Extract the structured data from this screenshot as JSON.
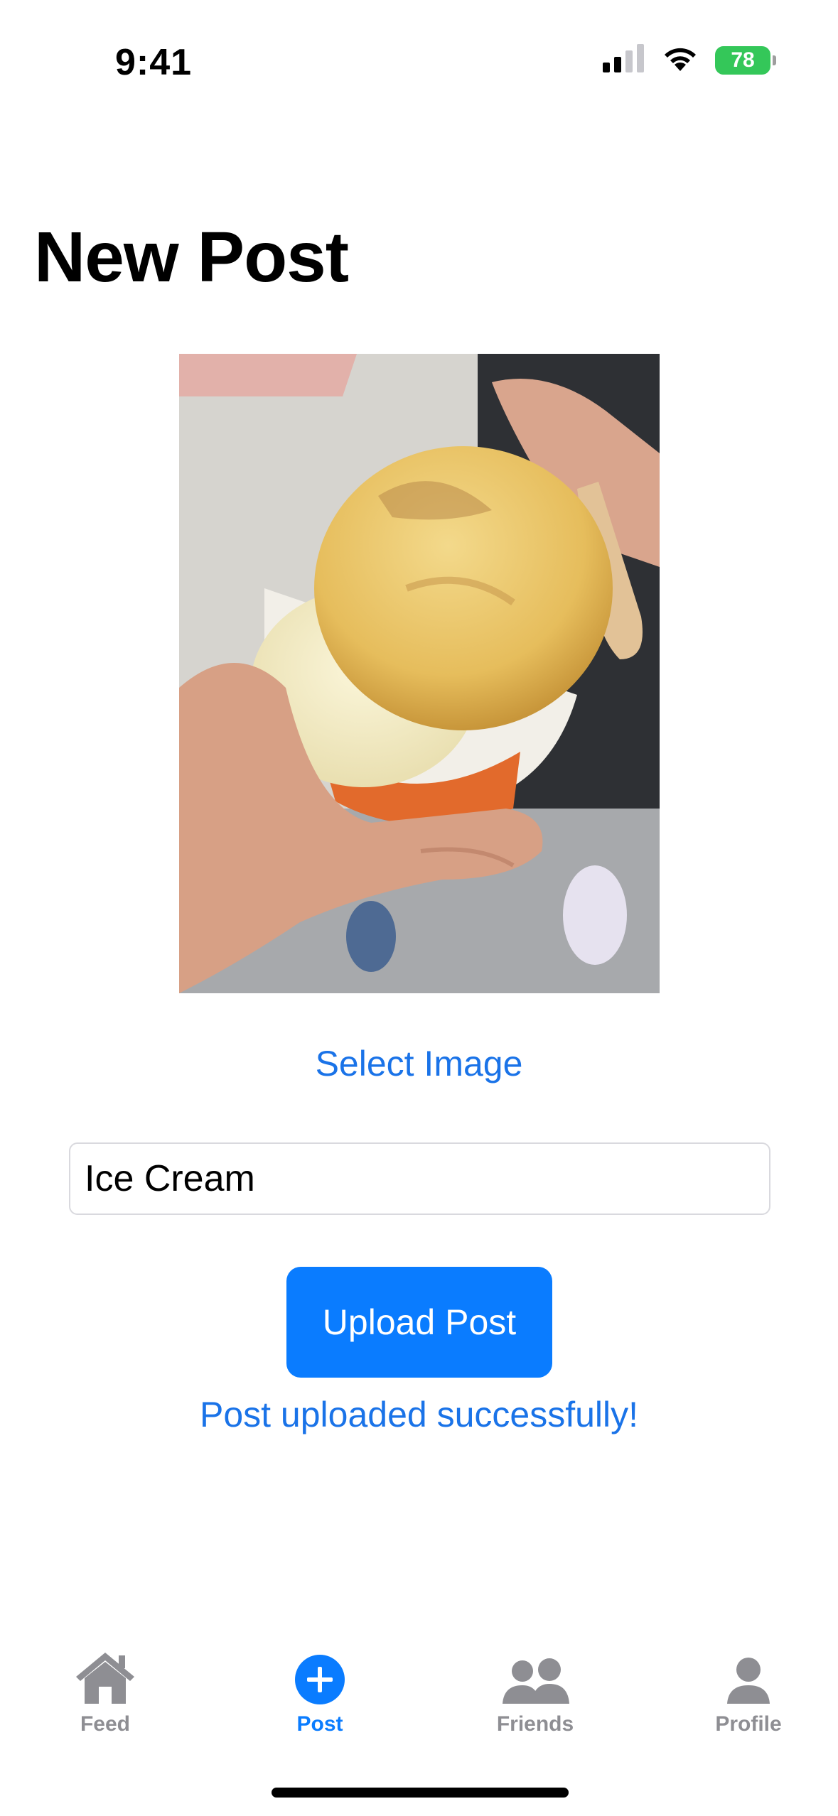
{
  "status_bar": {
    "time": "9:41",
    "battery_level": "78",
    "icons": [
      "cellular-signal-icon",
      "wifi-icon",
      "battery-charging-icon"
    ]
  },
  "page": {
    "title": "New Post"
  },
  "image_picker": {
    "select_label": "Select Image"
  },
  "caption": {
    "value": "Ice Cream"
  },
  "upload": {
    "button_label": "Upload Post",
    "status_message": "Post uploaded successfully!"
  },
  "tab_bar": {
    "items": [
      {
        "label": "Feed",
        "icon": "house-icon",
        "active": false
      },
      {
        "label": "Post",
        "icon": "plus-circle-icon",
        "active": true
      },
      {
        "label": "Friends",
        "icon": "people-icon",
        "active": false
      },
      {
        "label": "Profile",
        "icon": "person-icon",
        "active": false
      }
    ]
  },
  "colors": {
    "accent": "#0a7cff",
    "link": "#1a73e8",
    "inactive": "#8e8e93",
    "battery": "#34c759"
  }
}
